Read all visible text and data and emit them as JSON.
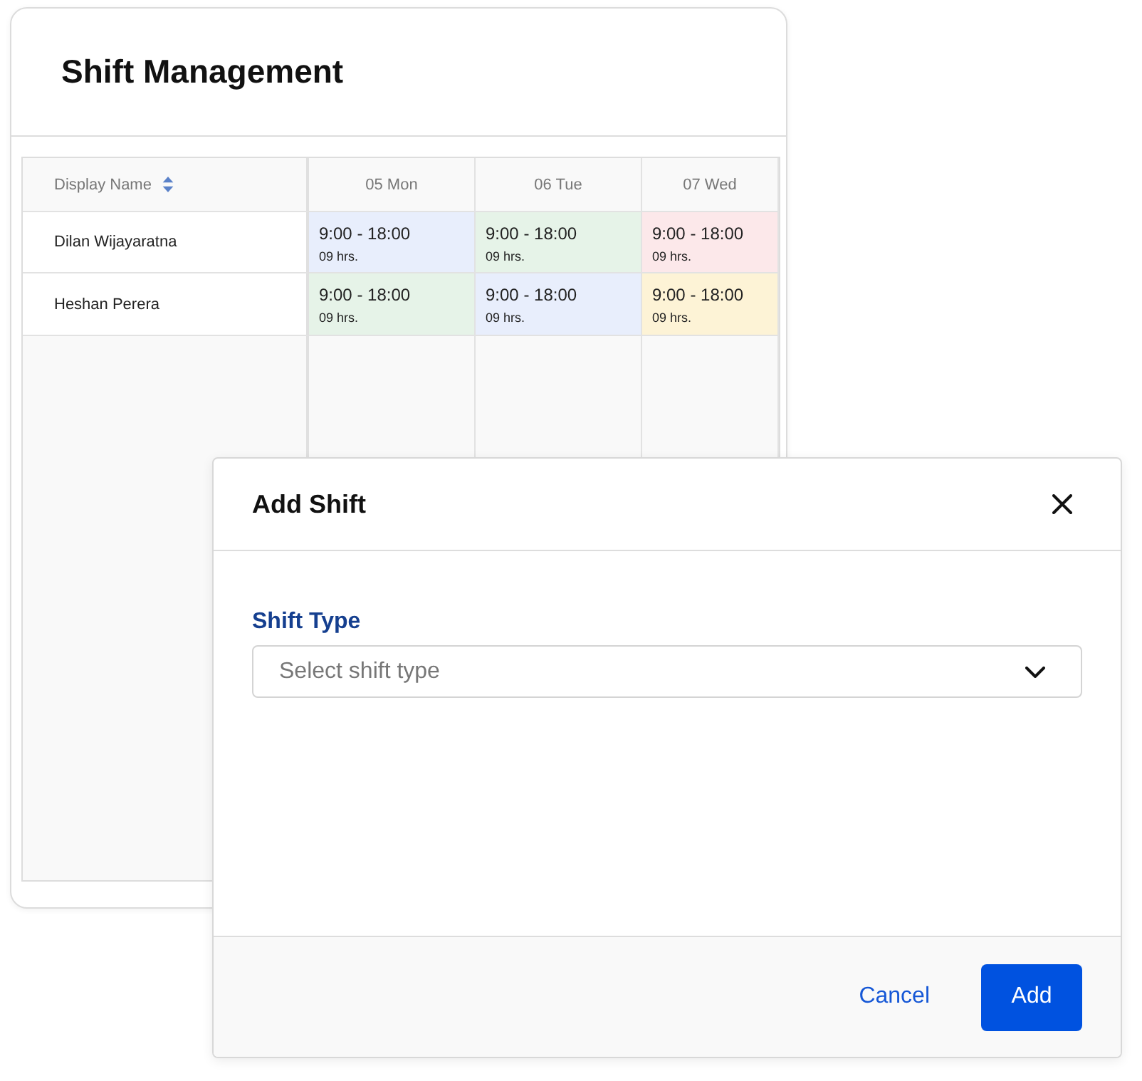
{
  "page": {
    "title": "Shift Management"
  },
  "table": {
    "columns": [
      {
        "label": "Display Name",
        "sortable": true
      },
      {
        "label": "05 Mon"
      },
      {
        "label": "06 Tue"
      },
      {
        "label": "07 Wed"
      }
    ],
    "rows": [
      {
        "name": "Dilan Wijayaratna",
        "shifts": [
          {
            "time": "9:00 - 18:00",
            "hours": "09 hrs.",
            "color": "#e8eefc"
          },
          {
            "time": "9:00 - 18:00",
            "hours": "09 hrs.",
            "color": "#e6f3e8"
          },
          {
            "time": "9:00 - 18:00",
            "hours": "09 hrs.",
            "color": "#fce8ea"
          }
        ]
      },
      {
        "name": "Heshan Perera",
        "shifts": [
          {
            "time": "9:00 - 18:00",
            "hours": "09 hrs.",
            "color": "#e6f3e8"
          },
          {
            "time": "9:00 - 18:00",
            "hours": "09 hrs.",
            "color": "#e8eefc"
          },
          {
            "time": "9:00 - 18:00",
            "hours": "09 hrs.",
            "color": "#fdf3d6"
          }
        ]
      }
    ]
  },
  "dialog": {
    "title": "Add Shift",
    "field_label": "Shift Type",
    "placeholder": "Select shift type",
    "buttons": [
      {
        "label": "Cancel",
        "kind": "link"
      },
      {
        "label": "Add",
        "kind": "primary"
      }
    ]
  }
}
